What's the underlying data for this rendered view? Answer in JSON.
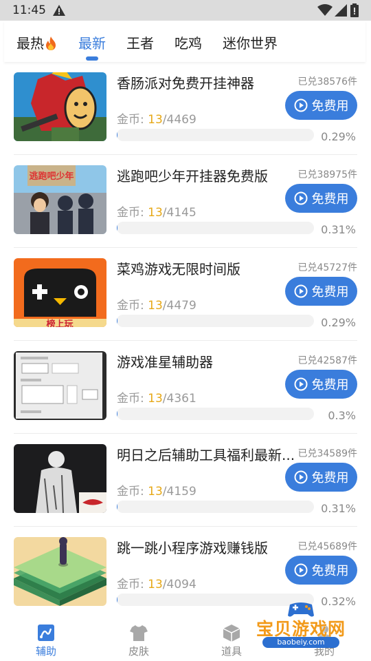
{
  "status_bar": {
    "time": "11:45"
  },
  "tabs": [
    {
      "label": "最热",
      "active": false
    },
    {
      "label": "最新",
      "active": true
    },
    {
      "label": "王者",
      "active": false
    },
    {
      "label": "吃鸡",
      "active": false
    },
    {
      "label": "迷你世界",
      "active": false
    }
  ],
  "items": [
    {
      "title": "香肠派对免费开挂神器",
      "redeemed": "已兑38576件",
      "coins_label": "金币: ",
      "coins_current": "13",
      "coins_total": "/4469",
      "button": "免费用",
      "percent": "0.29%",
      "progress": 0.0029
    },
    {
      "title": "逃跑吧少年开挂器免费版",
      "redeemed": "已兑38975件",
      "coins_label": "金币: ",
      "coins_current": "13",
      "coins_total": "/4145",
      "button": "免费用",
      "percent": "0.31%",
      "progress": 0.0031
    },
    {
      "title": "菜鸡游戏无限时间版",
      "redeemed": "已兑45727件",
      "coins_label": "金币: ",
      "coins_current": "13",
      "coins_total": "/4479",
      "button": "免费用",
      "percent": "0.29%",
      "progress": 0.0029
    },
    {
      "title": "游戏准星辅助器",
      "redeemed": "已兑42587件",
      "coins_label": "金币: ",
      "coins_current": "13",
      "coins_total": "/4361",
      "button": "免费用",
      "percent": "0.3%",
      "progress": 0.003
    },
    {
      "title": "明日之后辅助工具福利最新...",
      "redeemed": "已兑34589件",
      "coins_label": "金币: ",
      "coins_current": "13",
      "coins_total": "/4159",
      "button": "免费用",
      "percent": "0.31%",
      "progress": 0.0031
    },
    {
      "title": "跳一跳小程序游戏赚钱版",
      "redeemed": "已兑45689件",
      "coins_label": "金币: ",
      "coins_current": "13",
      "coins_total": "/4094",
      "button": "免费用",
      "percent": "0.32%",
      "progress": 0.0032
    }
  ],
  "thumb_text": {
    "item2": "逃跑吧少年",
    "item3": "榜上玩"
  },
  "bottom_nav": [
    {
      "label": "辅助",
      "active": true,
      "icon": "chart-icon"
    },
    {
      "label": "皮肤",
      "active": false,
      "icon": "shirt-icon"
    },
    {
      "label": "道具",
      "active": false,
      "icon": "box-icon"
    },
    {
      "label": "我的",
      "active": false,
      "icon": "person-icon"
    }
  ],
  "watermark": {
    "text": "宝贝游戏网",
    "domain": "baobeiy.com"
  },
  "colors": {
    "accent": "#3a7ddc",
    "coin": "#e6a817",
    "status_bar": "#dcdcdc"
  }
}
